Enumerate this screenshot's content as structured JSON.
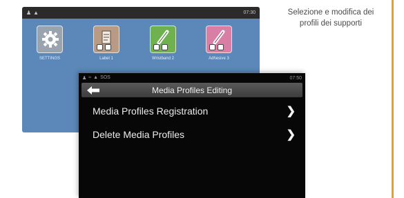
{
  "home_screen": {
    "status_time": "07:30",
    "tiles": [
      {
        "label": "SETTINGS"
      },
      {
        "label": "Label 1"
      },
      {
        "label": "Wristband 2"
      },
      {
        "label": "Adhesive 3"
      }
    ]
  },
  "media_profiles_screen": {
    "status_text": "SOS",
    "status_time": "07:50",
    "title": "Media Profiles Editing",
    "menu": [
      {
        "label": "Media Profiles Registration"
      },
      {
        "label": "Delete Media Profiles"
      }
    ]
  },
  "caption": {
    "line1": "Selezione e modifica dei",
    "line2": "profili dei supporti"
  },
  "colors": {
    "home_background": "#5b88b8",
    "front_background": "#070707",
    "accent_bar": "#e8a11e"
  },
  "icons": [
    "signal-icon",
    "gear-icon",
    "label-icon",
    "wristband-icon",
    "adhesive-icon",
    "back-arrow-icon",
    "chevron-right-icon"
  ]
}
